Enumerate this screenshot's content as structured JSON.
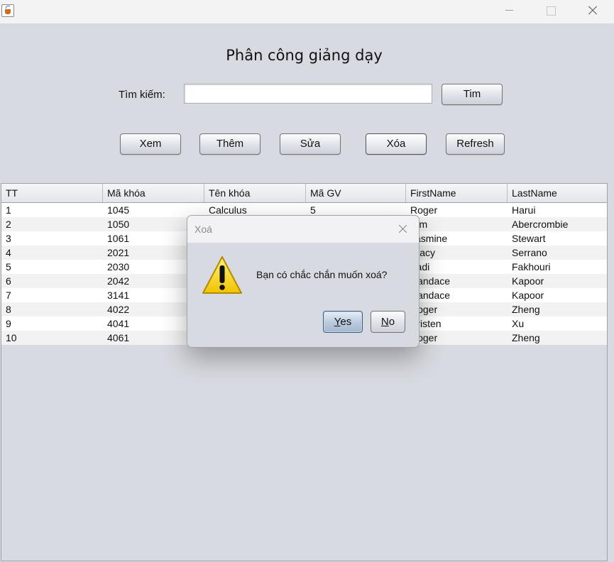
{
  "window": {
    "title": ""
  },
  "page": {
    "title": "Phân công giảng dạy",
    "search_label": "Tìm kiếm:",
    "search_value": "",
    "search_button": "Tim"
  },
  "toolbar": {
    "view": "Xem",
    "add": "Thêm",
    "edit": "Sửa",
    "delete": "Xóa",
    "refresh": "Refresh"
  },
  "table": {
    "columns": [
      "TT",
      "Mã khóa",
      "Tên khóa",
      "Mã GV",
      "FirstName",
      "LastName"
    ],
    "rows": [
      [
        "1",
        "1045",
        "Calculus",
        "5",
        "Roger",
        "Harui"
      ],
      [
        "2",
        "1050",
        "",
        "",
        "Kim",
        "Abercrombie"
      ],
      [
        "3",
        "1061",
        "",
        "",
        "Jasmine",
        "Stewart"
      ],
      [
        "4",
        "2021",
        "",
        "",
        "Stacy",
        "Serrano"
      ],
      [
        "5",
        "2030",
        "",
        "",
        "Fadi",
        "Fakhouri"
      ],
      [
        "6",
        "2042",
        "",
        "",
        "Candace",
        "Kapoor"
      ],
      [
        "7",
        "3141",
        "",
        "",
        "Candace",
        "Kapoor"
      ],
      [
        "8",
        "4022",
        "",
        "",
        "Roger",
        "Zheng"
      ],
      [
        "9",
        "4041",
        "",
        "",
        "Kristen",
        "Xu"
      ],
      [
        "10",
        "4061",
        "",
        "",
        "Roger",
        "Zheng"
      ]
    ]
  },
  "dialog": {
    "title": "Xoá",
    "message": "Bạn có chắc chắn muốn xoá?",
    "yes_mnemonic": "Y",
    "yes_rest": "es",
    "no_mnemonic": "N",
    "no_rest": "o",
    "icon": "warning-icon"
  },
  "colors": {
    "background": "#d8dae1",
    "dialog_default_button": "#b9c9de",
    "warning_yellow": "#f5d21a"
  }
}
